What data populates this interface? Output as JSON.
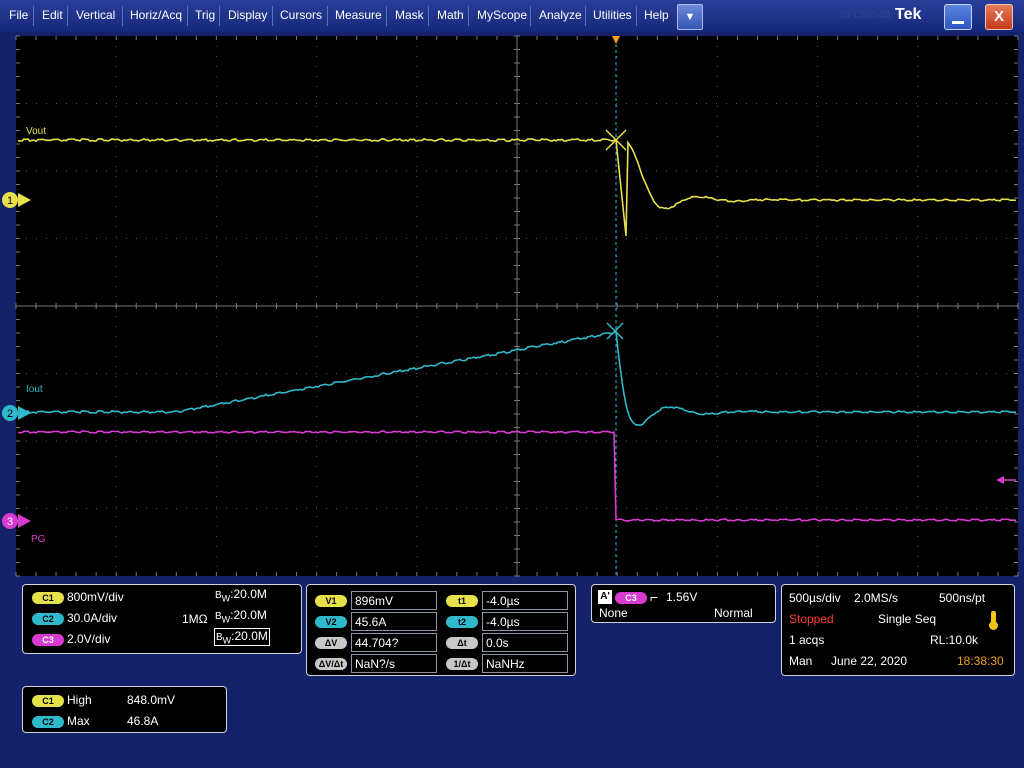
{
  "menu": [
    "File",
    "Edit",
    "Vertical",
    "Horiz/Acq",
    "Trig",
    "Display",
    "Cursors",
    "Measure",
    "Mask",
    "Math",
    "MyScope",
    "Analyze",
    "Utilities",
    "Help"
  ],
  "dropdown_glyph": "▼",
  "brand": "Tek",
  "brand_watermark": "DPO5054B",
  "close_glyph": "X",
  "channels": {
    "vout_label": "Vout",
    "iout_label": "Iout",
    "pg_label": "PG",
    "marker_1": "1",
    "marker_2": "2",
    "marker_3": "3",
    "colors": {
      "c1": "#e6e04a",
      "c2": "#2fb9cc",
      "c3": "#d93bd2"
    }
  },
  "channel_panel": [
    {
      "chip": "C1",
      "scale": "800mV/div",
      "impedance": "",
      "bw_b": "B",
      "bw_w": "W",
      "bw_value": ":20.0M"
    },
    {
      "chip": "C2",
      "scale": "30.0A/div",
      "impedance": "1MΩ",
      "bw_b": "B",
      "bw_w": "W",
      "bw_value": ":20.0M"
    },
    {
      "chip": "C3",
      "scale": "2.0V/div",
      "impedance": "",
      "bw_b": "B",
      "bw_w": "W",
      "bw_value": ":20.0M"
    }
  ],
  "cursor_panel": {
    "v1_label": "V1",
    "v1_value": "896mV",
    "v2_label": "V2",
    "v2_value": "45.6A",
    "dv_label": "ΔV",
    "dv_value": "44.704?",
    "dvdt_label": "ΔV/Δt",
    "dvdt_value": "NaN?/s",
    "t1_label": "t1",
    "t1_value": "-4.0µs",
    "t2_label": "t2",
    "t2_value": "-4.0µs",
    "dt_label": "Δt",
    "dt_value": "0.0s",
    "invdt_label": "1/Δt",
    "invdt_value": "NaNHz"
  },
  "trigger_panel": {
    "a_label": "A'",
    "source": "C3",
    "slope_glyph": "⌐",
    "level": "1.56V",
    "coupling": "None",
    "mode": "Normal"
  },
  "acq_panel": {
    "timebase": "500µs/div",
    "sample_rate": "2.0MS/s",
    "resolution": "500ns/pt",
    "state": "Stopped",
    "seq": "Single Seq",
    "acqs": "1 acqs",
    "record_length": "RL:10.0k",
    "mode": "Man",
    "date": "June 22, 2020",
    "time": "18:38:30"
  },
  "measure_panel": [
    {
      "chip": "C1",
      "name": "High",
      "value": "848.0mV"
    },
    {
      "chip": "C2",
      "name": "Max",
      "value": "46.8A"
    }
  ]
}
